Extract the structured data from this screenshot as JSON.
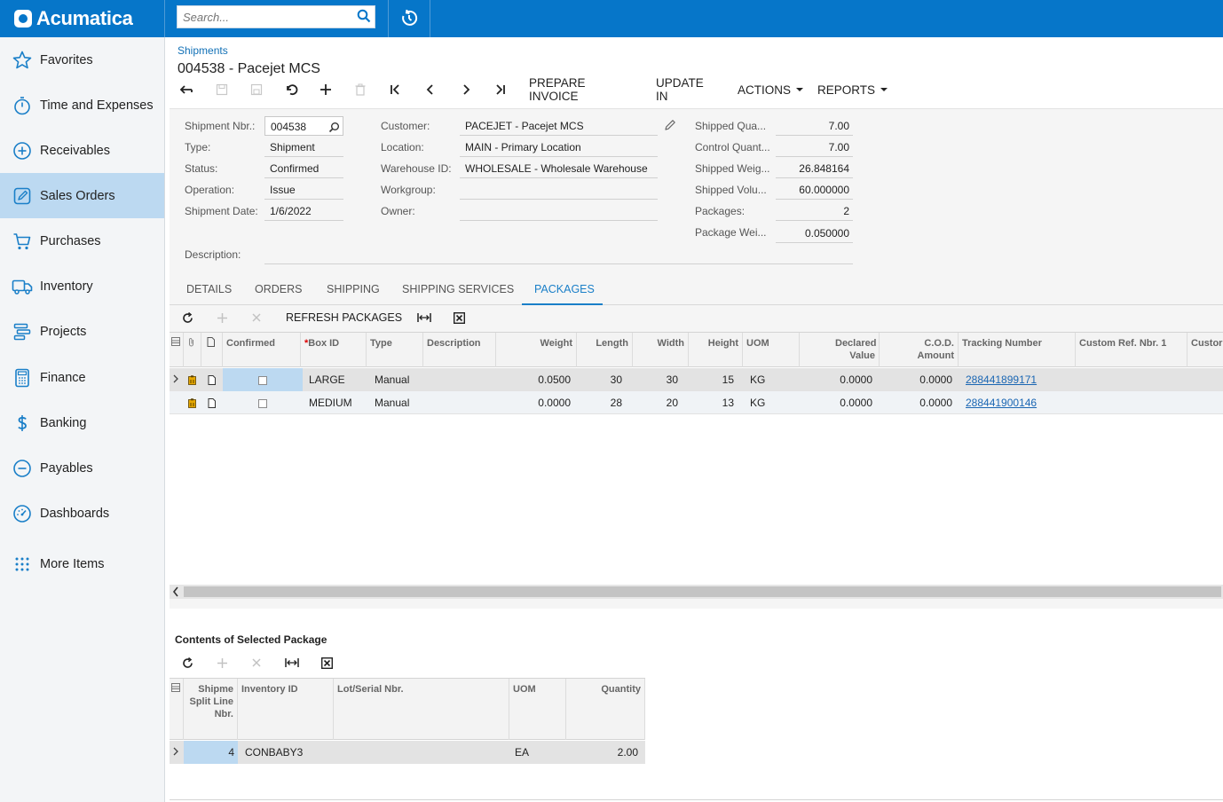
{
  "brand": {
    "name": "Acumatica"
  },
  "search": {
    "placeholder": "Search..."
  },
  "sidebar": {
    "items": [
      {
        "label": "Favorites",
        "icon": "star-icon"
      },
      {
        "label": "Time and Expenses",
        "icon": "stopwatch-icon"
      },
      {
        "label": "Receivables",
        "icon": "plus-circle-icon"
      },
      {
        "label": "Sales Orders",
        "icon": "edit-icon"
      },
      {
        "label": "Purchases",
        "icon": "cart-icon"
      },
      {
        "label": "Inventory",
        "icon": "truck-icon"
      },
      {
        "label": "Projects",
        "icon": "projects-icon"
      },
      {
        "label": "Finance",
        "icon": "calculator-icon"
      },
      {
        "label": "Banking",
        "icon": "dollar-icon"
      },
      {
        "label": "Payables",
        "icon": "minus-circle-icon"
      },
      {
        "label": "Dashboards",
        "icon": "gauge-icon"
      },
      {
        "label": "More Items",
        "icon": "grid-dots-icon"
      }
    ],
    "active": "Sales Orders"
  },
  "header": {
    "breadcrumb": "Shipments",
    "title": "004538 - Pacejet MCS"
  },
  "toolbar": {
    "prepare_invoice": "PREPARE INVOICE",
    "update_in": "UPDATE IN",
    "actions": "ACTIONS",
    "reports": "REPORTS"
  },
  "form": {
    "shipment_nbr": {
      "label": "Shipment Nbr.:",
      "value": "004538"
    },
    "type": {
      "label": "Type:",
      "value": "Shipment"
    },
    "status": {
      "label": "Status:",
      "value": "Confirmed"
    },
    "operation": {
      "label": "Operation:",
      "value": "Issue"
    },
    "shipment_date": {
      "label": "Shipment Date:",
      "value": "1/6/2022"
    },
    "description": {
      "label": "Description:",
      "value": ""
    },
    "customer": {
      "label": "Customer:",
      "value": "PACEJET - Pacejet MCS"
    },
    "location": {
      "label": "Location:",
      "value": "MAIN - Primary Location"
    },
    "warehouse_id": {
      "label": "Warehouse ID:",
      "value": "WHOLESALE - Wholesale Warehouse"
    },
    "workgroup": {
      "label": "Workgroup:",
      "value": ""
    },
    "owner": {
      "label": "Owner:",
      "value": ""
    },
    "shipped_quantity": {
      "label": "Shipped Qua...",
      "value": "7.00"
    },
    "control_quantity": {
      "label": "Control Quant...",
      "value": "7.00"
    },
    "shipped_weight": {
      "label": "Shipped Weig...",
      "value": "26.848164"
    },
    "shipped_volume": {
      "label": "Shipped Volu...",
      "value": "60.000000"
    },
    "packages": {
      "label": "Packages:",
      "value": "2"
    },
    "package_weight": {
      "label": "Package Wei...",
      "value": "0.050000"
    }
  },
  "tabs": [
    "DETAILS",
    "ORDERS",
    "SHIPPING",
    "SHIPPING SERVICES",
    "PACKAGES"
  ],
  "active_tab": "PACKAGES",
  "packages_toolbar": {
    "refresh": "REFRESH PACKAGES"
  },
  "packages_grid": {
    "columns": {
      "confirmed": "Confirmed",
      "box_id": "Box ID",
      "type": "Type",
      "description": "Description",
      "weight": "Weight",
      "length": "Length",
      "width": "Width",
      "height": "Height",
      "uom": "UOM",
      "declared_value": "Declared Value",
      "cod_amount": "C.O.D. Amount",
      "tracking_number": "Tracking Number",
      "custom_ref_1": "Custom Ref. Nbr. 1",
      "custom_ref_2": "Custor"
    },
    "rows": [
      {
        "confirmed": false,
        "box_id": "LARGE",
        "type": "Manual",
        "description": "",
        "weight": "0.0500",
        "length": "30",
        "width": "30",
        "height": "15",
        "uom": "KG",
        "declared_value": "0.0000",
        "cod_amount": "0.0000",
        "tracking_number": "288441899171",
        "custom_ref_1": ""
      },
      {
        "confirmed": false,
        "box_id": "MEDIUM",
        "type": "Manual",
        "description": "",
        "weight": "0.0000",
        "length": "28",
        "width": "20",
        "height": "13",
        "uom": "KG",
        "declared_value": "0.0000",
        "cod_amount": "0.0000",
        "tracking_number": "288441900146",
        "custom_ref_1": ""
      }
    ]
  },
  "contents": {
    "title": "Contents of Selected Package",
    "columns": {
      "line": "Shipme Split Line Nbr.",
      "inventory_id": "Inventory ID",
      "lot_serial": "Lot/Serial Nbr.",
      "uom": "UOM",
      "quantity": "Quantity"
    },
    "rows": [
      {
        "line": "4",
        "inventory_id": "CONBABY3",
        "lot_serial": "",
        "uom": "EA",
        "quantity": "2.00"
      }
    ]
  }
}
